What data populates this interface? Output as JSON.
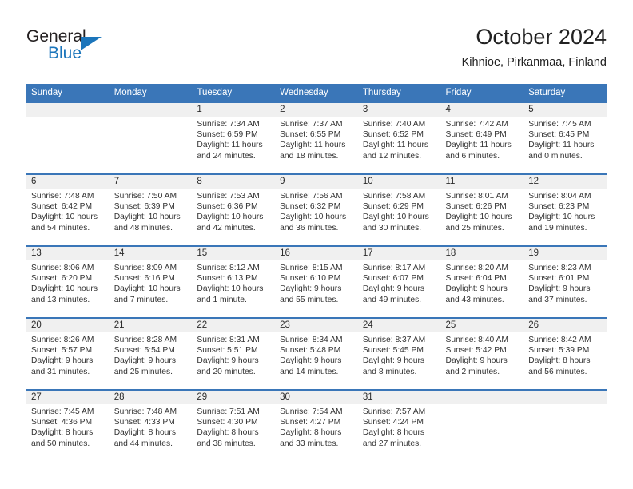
{
  "brand": {
    "name_part1": "General",
    "name_part2": "Blue",
    "triangle_color": "#1b75bb"
  },
  "header": {
    "title": "October 2024",
    "location": "Kihnioe, Pirkanmaa, Finland"
  },
  "theme": {
    "header_blue": "#3a76b8",
    "daynum_band": "#f0f0f0",
    "text": "#333333"
  },
  "weekday_headers": [
    "Sunday",
    "Monday",
    "Tuesday",
    "Wednesday",
    "Thursday",
    "Friday",
    "Saturday"
  ],
  "weeks": [
    [
      {
        "day": "",
        "empty": true,
        "sunrise": "",
        "sunset": "",
        "daylight_line1": "",
        "daylight_line2": ""
      },
      {
        "day": "",
        "empty": true,
        "sunrise": "",
        "sunset": "",
        "daylight_line1": "",
        "daylight_line2": ""
      },
      {
        "day": "1",
        "empty": false,
        "sunrise": "Sunrise: 7:34 AM",
        "sunset": "Sunset: 6:59 PM",
        "daylight_line1": "Daylight: 11 hours",
        "daylight_line2": "and 24 minutes."
      },
      {
        "day": "2",
        "empty": false,
        "sunrise": "Sunrise: 7:37 AM",
        "sunset": "Sunset: 6:55 PM",
        "daylight_line1": "Daylight: 11 hours",
        "daylight_line2": "and 18 minutes."
      },
      {
        "day": "3",
        "empty": false,
        "sunrise": "Sunrise: 7:40 AM",
        "sunset": "Sunset: 6:52 PM",
        "daylight_line1": "Daylight: 11 hours",
        "daylight_line2": "and 12 minutes."
      },
      {
        "day": "4",
        "empty": false,
        "sunrise": "Sunrise: 7:42 AM",
        "sunset": "Sunset: 6:49 PM",
        "daylight_line1": "Daylight: 11 hours",
        "daylight_line2": "and 6 minutes."
      },
      {
        "day": "5",
        "empty": false,
        "sunrise": "Sunrise: 7:45 AM",
        "sunset": "Sunset: 6:45 PM",
        "daylight_line1": "Daylight: 11 hours",
        "daylight_line2": "and 0 minutes."
      }
    ],
    [
      {
        "day": "6",
        "empty": false,
        "sunrise": "Sunrise: 7:48 AM",
        "sunset": "Sunset: 6:42 PM",
        "daylight_line1": "Daylight: 10 hours",
        "daylight_line2": "and 54 minutes."
      },
      {
        "day": "7",
        "empty": false,
        "sunrise": "Sunrise: 7:50 AM",
        "sunset": "Sunset: 6:39 PM",
        "daylight_line1": "Daylight: 10 hours",
        "daylight_line2": "and 48 minutes."
      },
      {
        "day": "8",
        "empty": false,
        "sunrise": "Sunrise: 7:53 AM",
        "sunset": "Sunset: 6:36 PM",
        "daylight_line1": "Daylight: 10 hours",
        "daylight_line2": "and 42 minutes."
      },
      {
        "day": "9",
        "empty": false,
        "sunrise": "Sunrise: 7:56 AM",
        "sunset": "Sunset: 6:32 PM",
        "daylight_line1": "Daylight: 10 hours",
        "daylight_line2": "and 36 minutes."
      },
      {
        "day": "10",
        "empty": false,
        "sunrise": "Sunrise: 7:58 AM",
        "sunset": "Sunset: 6:29 PM",
        "daylight_line1": "Daylight: 10 hours",
        "daylight_line2": "and 30 minutes."
      },
      {
        "day": "11",
        "empty": false,
        "sunrise": "Sunrise: 8:01 AM",
        "sunset": "Sunset: 6:26 PM",
        "daylight_line1": "Daylight: 10 hours",
        "daylight_line2": "and 25 minutes."
      },
      {
        "day": "12",
        "empty": false,
        "sunrise": "Sunrise: 8:04 AM",
        "sunset": "Sunset: 6:23 PM",
        "daylight_line1": "Daylight: 10 hours",
        "daylight_line2": "and 19 minutes."
      }
    ],
    [
      {
        "day": "13",
        "empty": false,
        "sunrise": "Sunrise: 8:06 AM",
        "sunset": "Sunset: 6:20 PM",
        "daylight_line1": "Daylight: 10 hours",
        "daylight_line2": "and 13 minutes."
      },
      {
        "day": "14",
        "empty": false,
        "sunrise": "Sunrise: 8:09 AM",
        "sunset": "Sunset: 6:16 PM",
        "daylight_line1": "Daylight: 10 hours",
        "daylight_line2": "and 7 minutes."
      },
      {
        "day": "15",
        "empty": false,
        "sunrise": "Sunrise: 8:12 AM",
        "sunset": "Sunset: 6:13 PM",
        "daylight_line1": "Daylight: 10 hours",
        "daylight_line2": "and 1 minute."
      },
      {
        "day": "16",
        "empty": false,
        "sunrise": "Sunrise: 8:15 AM",
        "sunset": "Sunset: 6:10 PM",
        "daylight_line1": "Daylight: 9 hours",
        "daylight_line2": "and 55 minutes."
      },
      {
        "day": "17",
        "empty": false,
        "sunrise": "Sunrise: 8:17 AM",
        "sunset": "Sunset: 6:07 PM",
        "daylight_line1": "Daylight: 9 hours",
        "daylight_line2": "and 49 minutes."
      },
      {
        "day": "18",
        "empty": false,
        "sunrise": "Sunrise: 8:20 AM",
        "sunset": "Sunset: 6:04 PM",
        "daylight_line1": "Daylight: 9 hours",
        "daylight_line2": "and 43 minutes."
      },
      {
        "day": "19",
        "empty": false,
        "sunrise": "Sunrise: 8:23 AM",
        "sunset": "Sunset: 6:01 PM",
        "daylight_line1": "Daylight: 9 hours",
        "daylight_line2": "and 37 minutes."
      }
    ],
    [
      {
        "day": "20",
        "empty": false,
        "sunrise": "Sunrise: 8:26 AM",
        "sunset": "Sunset: 5:57 PM",
        "daylight_line1": "Daylight: 9 hours",
        "daylight_line2": "and 31 minutes."
      },
      {
        "day": "21",
        "empty": false,
        "sunrise": "Sunrise: 8:28 AM",
        "sunset": "Sunset: 5:54 PM",
        "daylight_line1": "Daylight: 9 hours",
        "daylight_line2": "and 25 minutes."
      },
      {
        "day": "22",
        "empty": false,
        "sunrise": "Sunrise: 8:31 AM",
        "sunset": "Sunset: 5:51 PM",
        "daylight_line1": "Daylight: 9 hours",
        "daylight_line2": "and 20 minutes."
      },
      {
        "day": "23",
        "empty": false,
        "sunrise": "Sunrise: 8:34 AM",
        "sunset": "Sunset: 5:48 PM",
        "daylight_line1": "Daylight: 9 hours",
        "daylight_line2": "and 14 minutes."
      },
      {
        "day": "24",
        "empty": false,
        "sunrise": "Sunrise: 8:37 AM",
        "sunset": "Sunset: 5:45 PM",
        "daylight_line1": "Daylight: 9 hours",
        "daylight_line2": "and 8 minutes."
      },
      {
        "day": "25",
        "empty": false,
        "sunrise": "Sunrise: 8:40 AM",
        "sunset": "Sunset: 5:42 PM",
        "daylight_line1": "Daylight: 9 hours",
        "daylight_line2": "and 2 minutes."
      },
      {
        "day": "26",
        "empty": false,
        "sunrise": "Sunrise: 8:42 AM",
        "sunset": "Sunset: 5:39 PM",
        "daylight_line1": "Daylight: 8 hours",
        "daylight_line2": "and 56 minutes."
      }
    ],
    [
      {
        "day": "27",
        "empty": false,
        "sunrise": "Sunrise: 7:45 AM",
        "sunset": "Sunset: 4:36 PM",
        "daylight_line1": "Daylight: 8 hours",
        "daylight_line2": "and 50 minutes."
      },
      {
        "day": "28",
        "empty": false,
        "sunrise": "Sunrise: 7:48 AM",
        "sunset": "Sunset: 4:33 PM",
        "daylight_line1": "Daylight: 8 hours",
        "daylight_line2": "and 44 minutes."
      },
      {
        "day": "29",
        "empty": false,
        "sunrise": "Sunrise: 7:51 AM",
        "sunset": "Sunset: 4:30 PM",
        "daylight_line1": "Daylight: 8 hours",
        "daylight_line2": "and 38 minutes."
      },
      {
        "day": "30",
        "empty": false,
        "sunrise": "Sunrise: 7:54 AM",
        "sunset": "Sunset: 4:27 PM",
        "daylight_line1": "Daylight: 8 hours",
        "daylight_line2": "and 33 minutes."
      },
      {
        "day": "31",
        "empty": false,
        "sunrise": "Sunrise: 7:57 AM",
        "sunset": "Sunset: 4:24 PM",
        "daylight_line1": "Daylight: 8 hours",
        "daylight_line2": "and 27 minutes."
      },
      {
        "day": "",
        "empty": true,
        "sunrise": "",
        "sunset": "",
        "daylight_line1": "",
        "daylight_line2": ""
      },
      {
        "day": "",
        "empty": true,
        "sunrise": "",
        "sunset": "",
        "daylight_line1": "",
        "daylight_line2": ""
      }
    ]
  ]
}
